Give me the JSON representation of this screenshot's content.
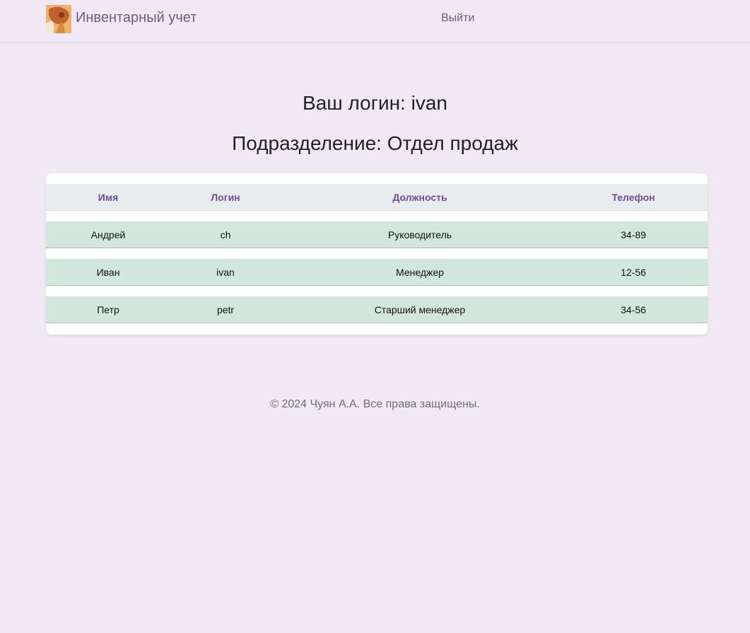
{
  "header": {
    "brand_name": "Инвентарный учет",
    "logout_label": "Выйти"
  },
  "main": {
    "login_heading": "Ваш логин: ivan",
    "department_heading": "Подразделение: Отдел продаж"
  },
  "table": {
    "columns": [
      "Имя",
      "Логин",
      "Должность",
      "Телефон"
    ],
    "rows": [
      [
        "Андрей",
        "ch",
        "Руководитель",
        "34-89"
      ],
      [
        "Иван",
        "ivan",
        "Менеджер",
        "12-56"
      ],
      [
        "Петр",
        "petr",
        "Старший менеджер",
        "34-56"
      ]
    ]
  },
  "footer": {
    "copyright": "© 2024 Чуян А.А. Все права защищены."
  },
  "colors": {
    "background": "#f0e9f5",
    "accent": "#6c5a86",
    "header_cell": "#e9ecef",
    "row_cell": "#d1e7dd"
  }
}
